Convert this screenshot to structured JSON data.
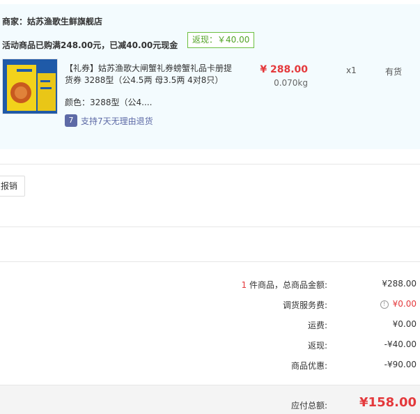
{
  "merchant": {
    "label": "商家：姑苏渔歌生鲜旗舰店"
  },
  "promotion": {
    "text": "活动商品已购满248.00元，已减40.00元现金",
    "rebate_tag": "返现：￥40.00"
  },
  "product": {
    "title": "【礼券】姑苏渔歌大闸蟹礼券螃蟹礼品卡册提货券 3288型（公4.5两 母3.5两 4对8只）",
    "spec": "颜色：3288型（公4....",
    "return_icon": "7",
    "return_text": "支持7天无理由退货",
    "price": "¥ 288.00",
    "weight": "0.070kg",
    "quantity": "x1",
    "stock": "有货"
  },
  "invoice": {
    "button_label": "报销"
  },
  "summary": {
    "items_count": "1",
    "items_label": " 件商品，总商品金额:",
    "items_value": "¥288.00",
    "service_label": "调货服务费:",
    "service_value": "¥0.00",
    "shipping_label": "运费:",
    "shipping_value": "¥0.00",
    "cashback_label": "返现:",
    "cashback_value": "-¥40.00",
    "discount_label": "商品优惠:",
    "discount_value": "-¥90.00"
  },
  "total": {
    "label": "应付总额:",
    "value": "¥158.00"
  },
  "colors": {
    "accent_red": "#e4393c",
    "panel_bg": "#f3fbfe",
    "rebate_green": "#52a327",
    "return_blue": "#5d6aa6"
  }
}
